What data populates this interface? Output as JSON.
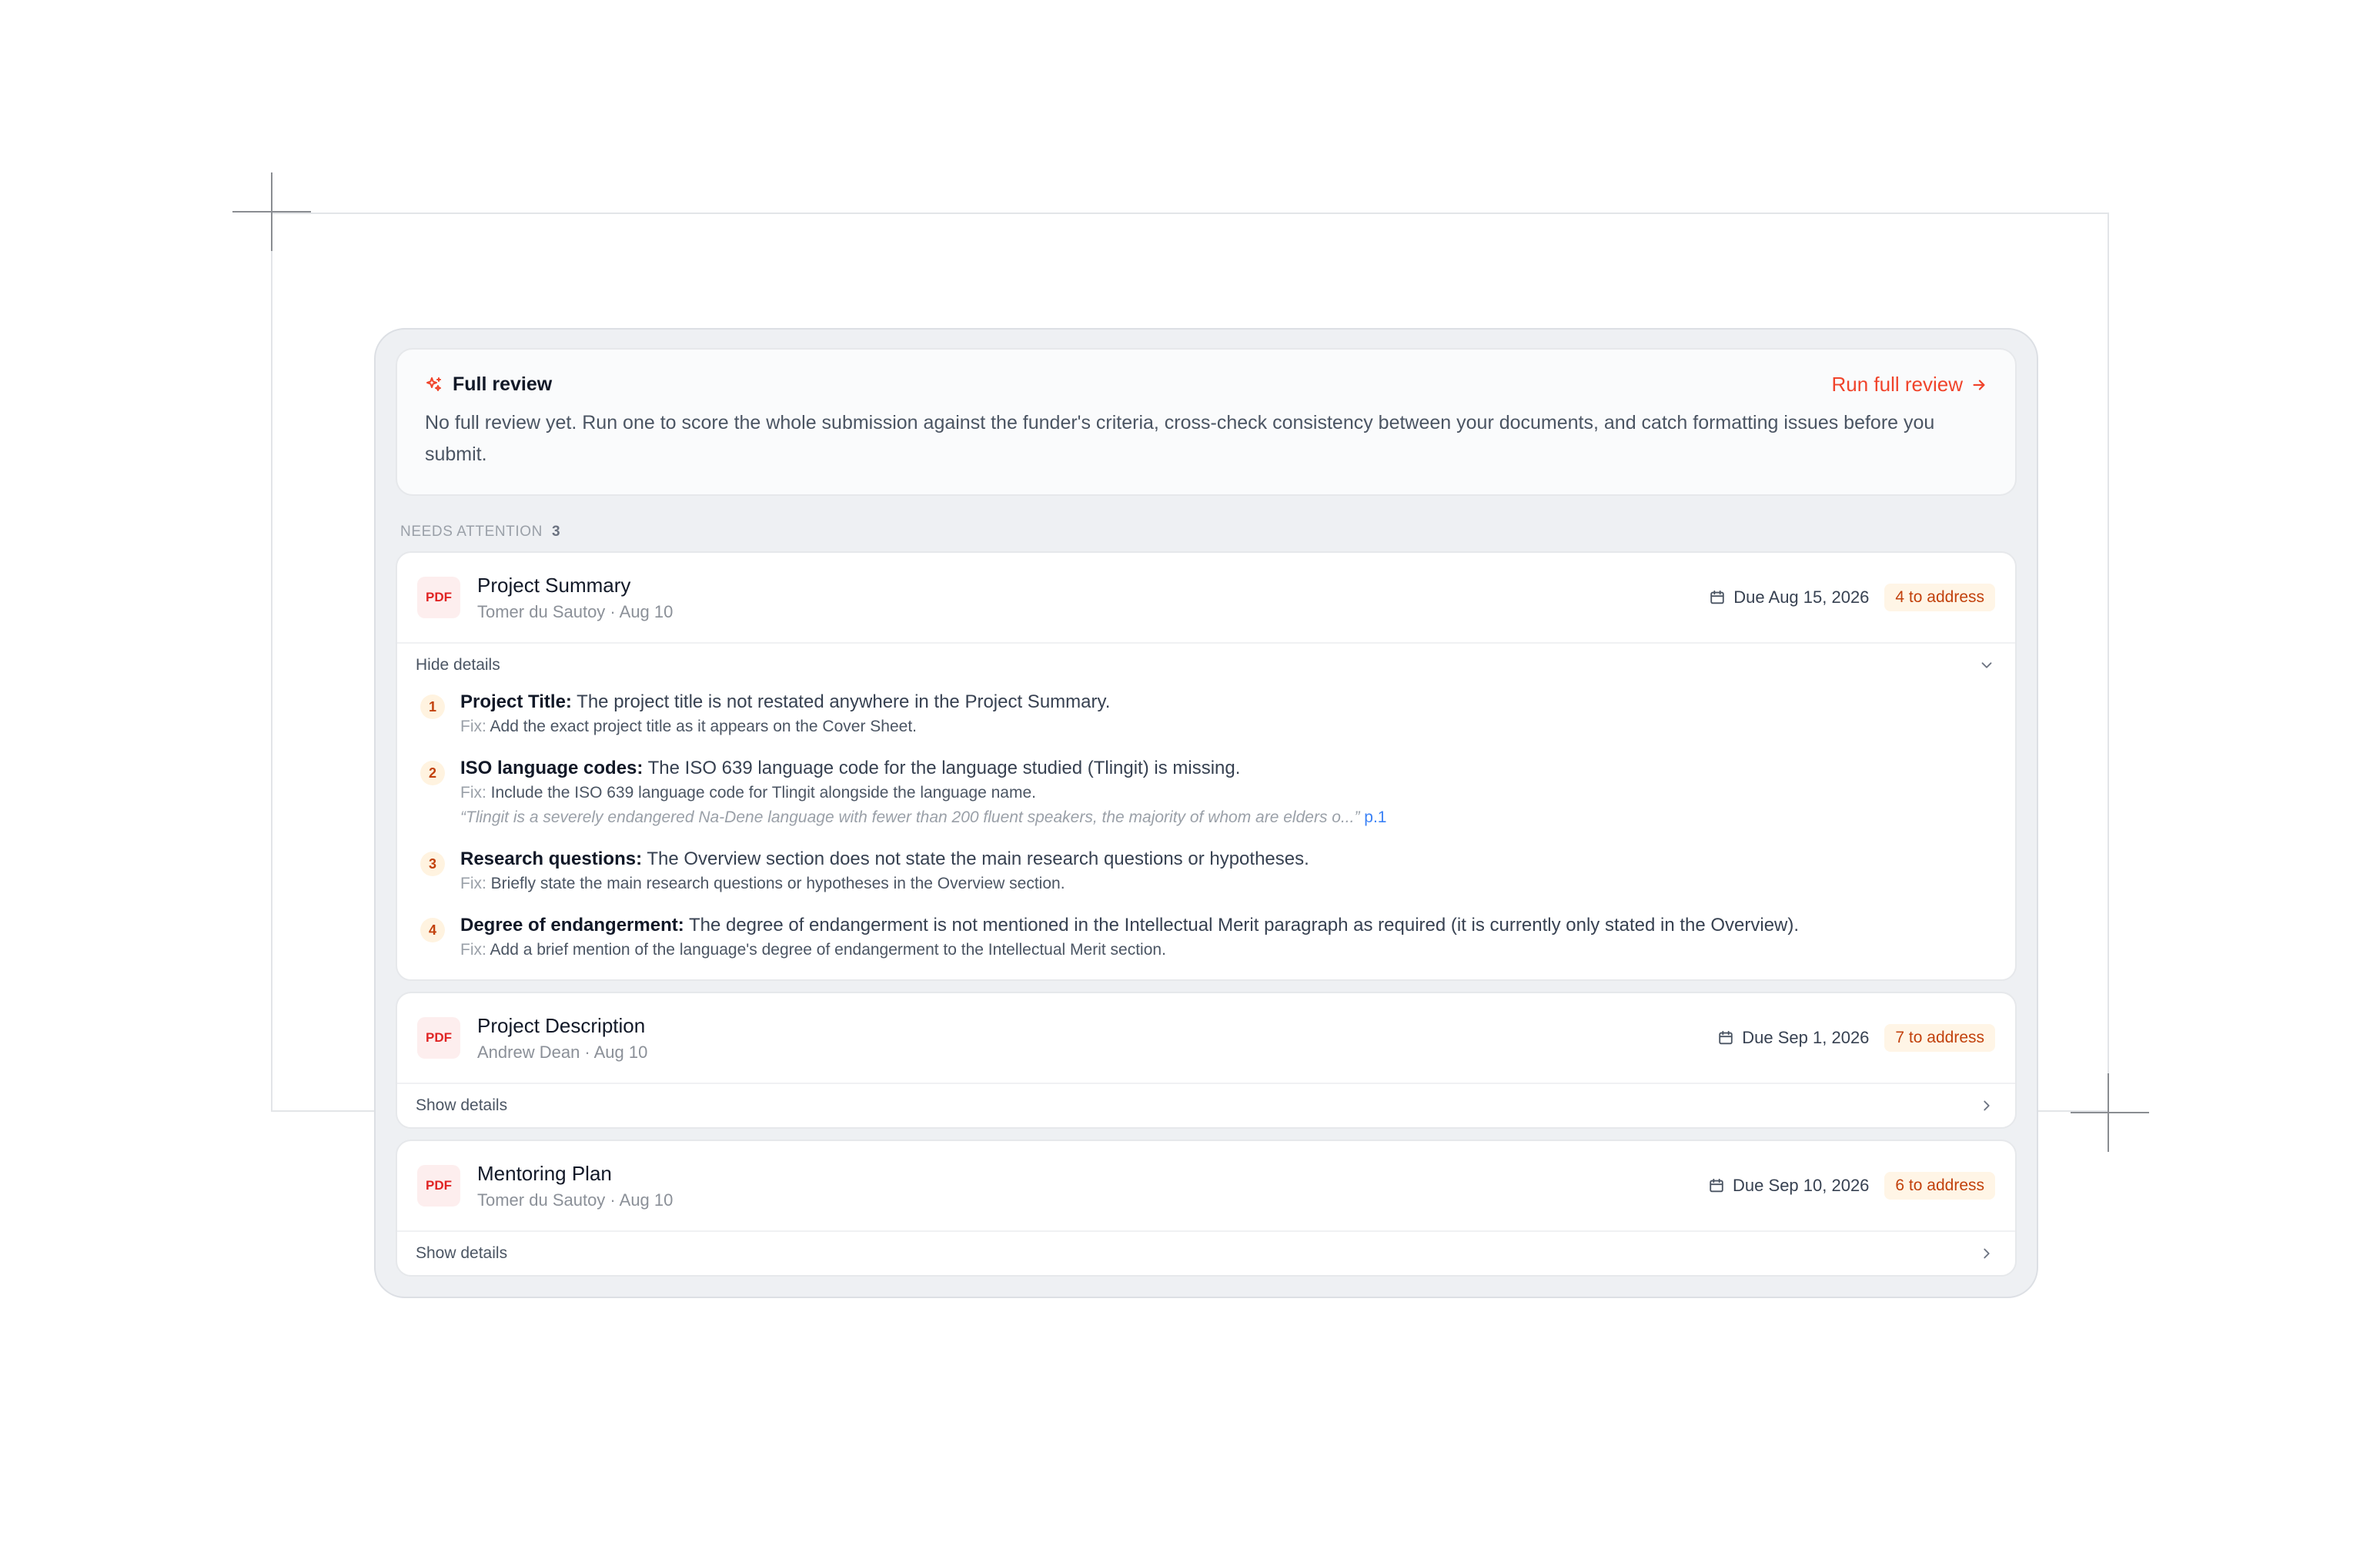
{
  "review": {
    "title": "Full review",
    "run_label": "Run full review",
    "description": "No full review yet. Run one to score the whole submission against the funder's criteria, cross-check consistency between your documents, and catch formatting issues before you submit."
  },
  "section": {
    "label": "NEEDS ATTENTION",
    "count": "3"
  },
  "documents": [
    {
      "badge": "PDF",
      "name": "Project Summary",
      "meta": "Tomer du Sautoy · Aug 10",
      "due": "Due Aug 15, 2026",
      "to_address": "4 to address",
      "toggle": "Hide details",
      "expanded": true,
      "issues": [
        {
          "n": "1",
          "title": "Project Title:",
          "text": " The project title is not restated anywhere in the Project Summary.",
          "fix_label": "Fix:",
          "fix": " Add the exact project title as it appears on the Cover Sheet."
        },
        {
          "n": "2",
          "title": "ISO language codes:",
          "text": " The ISO 639 language code for the language studied (Tlingit) is missing.",
          "fix_label": "Fix:",
          "fix": " Include the ISO 639 language code for Tlingit alongside the language name.",
          "quote": "“Tlingit is a severely endangered Na-Dene language with fewer than 200 fluent speakers, the majority of whom are elders o...”",
          "page": "p.1"
        },
        {
          "n": "3",
          "title": "Research questions:",
          "text": " The Overview section does not state the main research questions or hypotheses.",
          "fix_label": "Fix:",
          "fix": " Briefly state the main research questions or hypotheses in the Overview section."
        },
        {
          "n": "4",
          "title": "Degree of endangerment:",
          "text": " The degree of endangerment is not mentioned in the Intellectual Merit paragraph as required (it is currently only stated in the Overview).",
          "fix_label": "Fix:",
          "fix": " Add a brief mention of the language's degree of endangerment to the Intellectual Merit section."
        }
      ]
    },
    {
      "badge": "PDF",
      "name": "Project Description",
      "meta": "Andrew Dean · Aug 10",
      "due": "Due Sep 1, 2026",
      "to_address": "7 to address",
      "toggle": "Show details",
      "expanded": false
    },
    {
      "badge": "PDF",
      "name": "Mentoring Plan",
      "meta": "Tomer du Sautoy · Aug 10",
      "due": "Due Sep 10, 2026",
      "to_address": "6 to address",
      "toggle": "Show details",
      "expanded": false
    }
  ],
  "colors": {
    "accent": "#f0442b",
    "badge_bg": "#fff5e6",
    "badge_text": "#c2410c",
    "link": "#3b82f6"
  },
  "icons": {
    "review": "sparkle-icon",
    "run": "arrow-right-icon",
    "due": "calendar-icon",
    "collapse": "chevron-down-icon",
    "expand": "chevron-right-icon"
  }
}
